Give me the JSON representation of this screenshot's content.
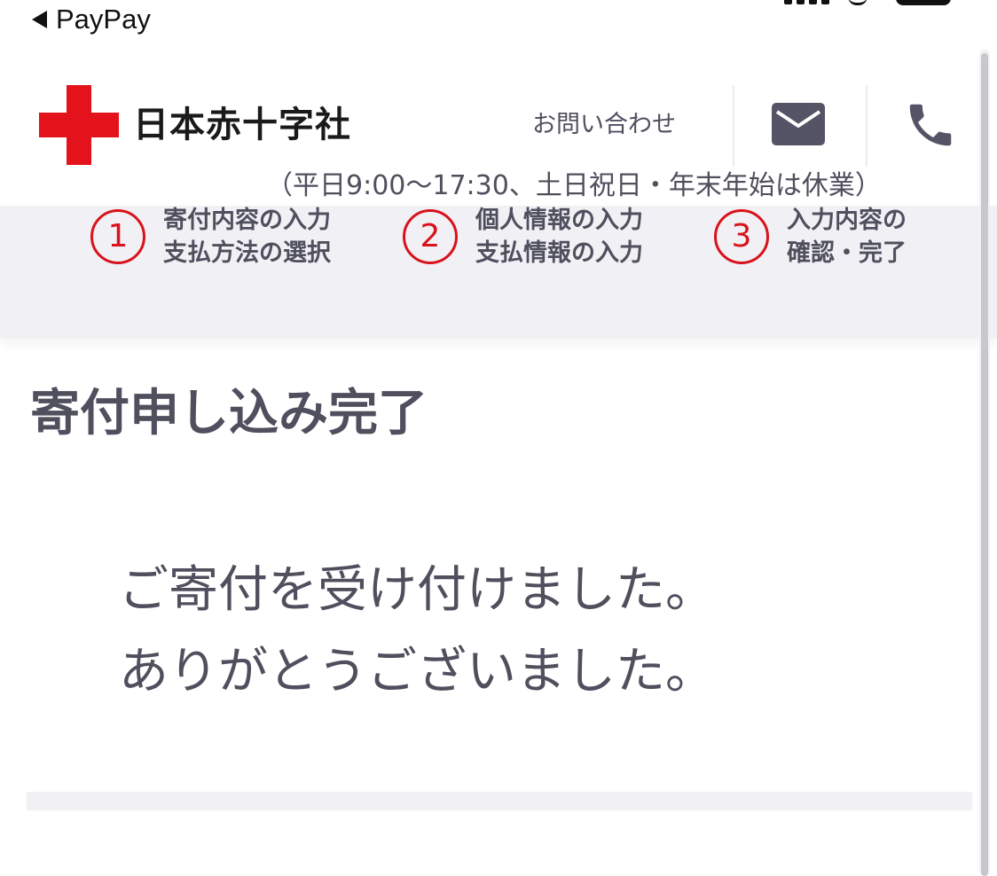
{
  "status_bar": {
    "back_label": "PayPay"
  },
  "header": {
    "logo_text": "日本赤十字社",
    "contact_label": "お問い合わせ",
    "hours_note": "（平日9:00〜17:30、土日祝日・年末年始は休業）",
    "icons": [
      "red-cross-icon",
      "mail-icon",
      "phone-icon"
    ],
    "brand_color": "#e3121b"
  },
  "steps": [
    {
      "number": "1",
      "line1": "寄付内容の入力",
      "line2": "支払方法の選択"
    },
    {
      "number": "2",
      "line1": "個人情報の入力",
      "line2": "支払情報の入力"
    },
    {
      "number": "3",
      "line1": "入力内容の",
      "line2": "確認・完了"
    }
  ],
  "main": {
    "title": "寄付申し込み完了",
    "message_line1": "ご寄付を受け付けました。",
    "message_line2": "ありがとうございました。"
  },
  "colors": {
    "text": "#4f4f5e",
    "step_accent": "#d9121b",
    "band_background": "#f1f1f5"
  }
}
